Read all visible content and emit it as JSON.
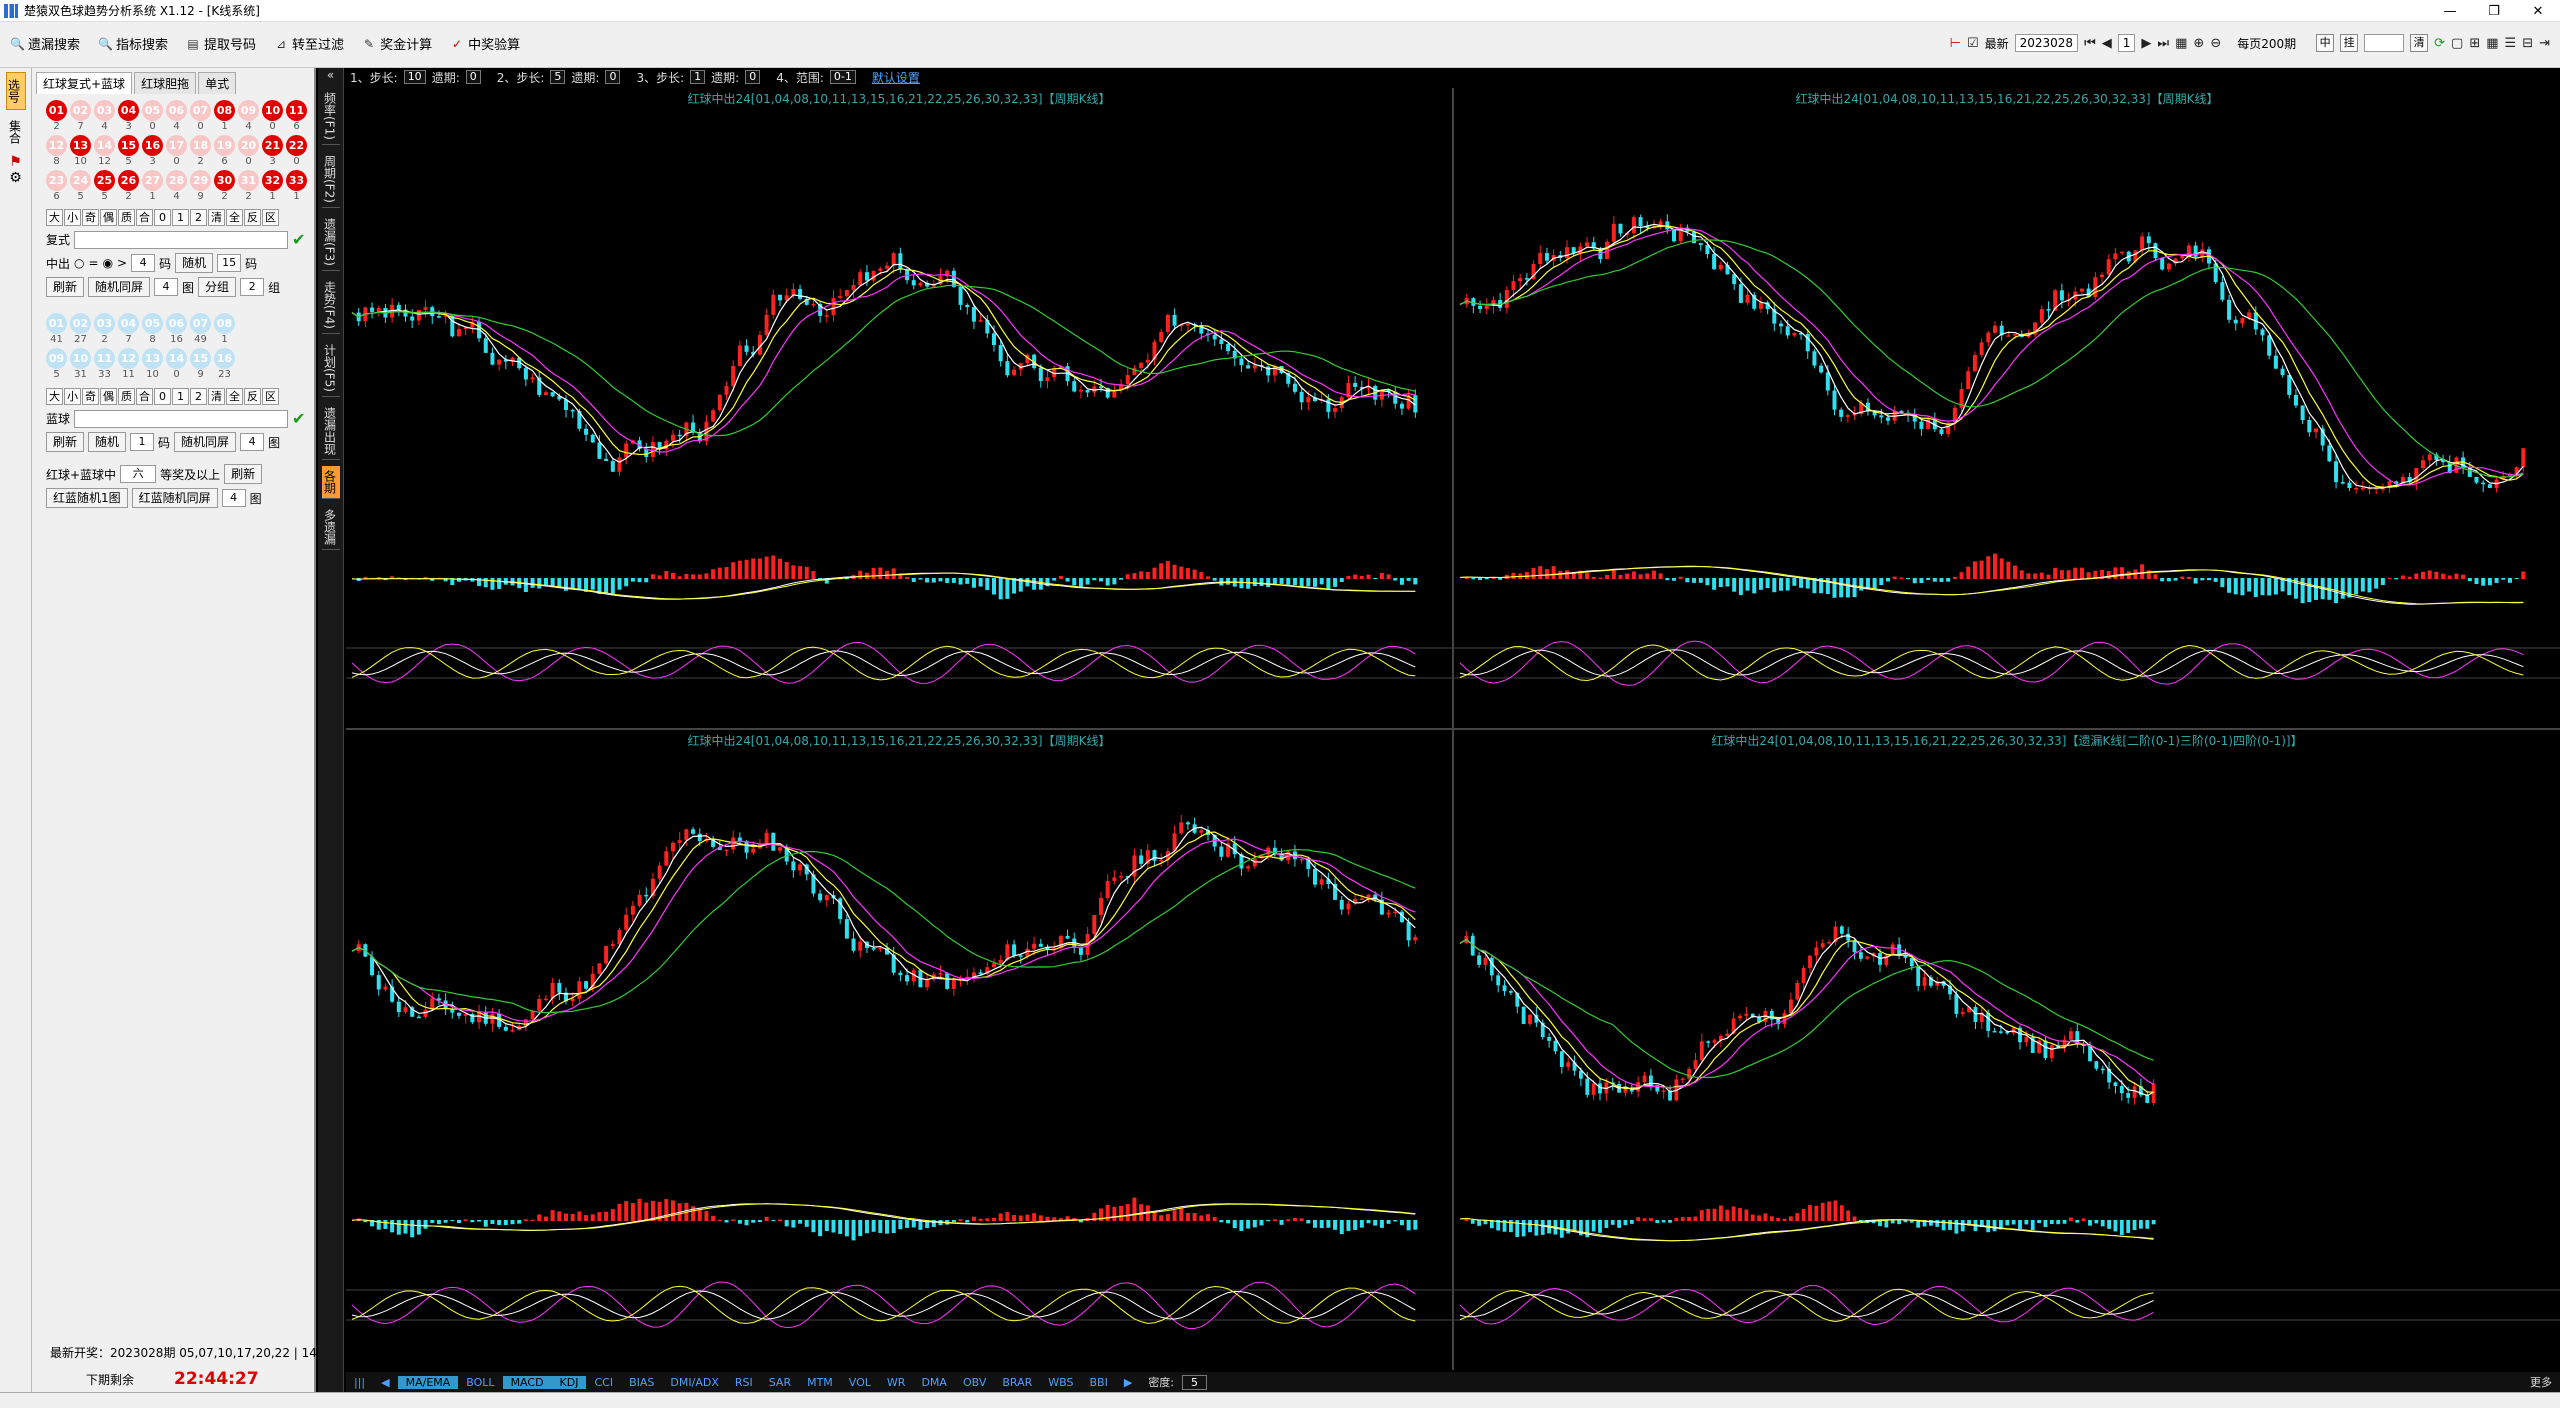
{
  "window": {
    "title": "楚猿双色球趋势分析系统 X1.12 - [K线系统]"
  },
  "toolbar": {
    "items": [
      {
        "name": "search",
        "label": "遗漏搜索"
      },
      {
        "name": "indicator",
        "label": "指标搜索"
      },
      {
        "name": "extract",
        "label": "提取号码"
      },
      {
        "name": "filter",
        "label": "转至过滤"
      },
      {
        "name": "prize",
        "label": "奖金计算"
      },
      {
        "name": "verify",
        "label": "中奖验算"
      }
    ],
    "latest_label": "最新",
    "period_value": "2023028",
    "page_num": "1",
    "per_page_label": "每页200期",
    "mid_label": "中",
    "hang_label": "挂",
    "clear_label": "清"
  },
  "leftstrip": {
    "tabs": [
      "选号",
      "集合"
    ]
  },
  "panel": {
    "tabs": [
      "红球复式+蓝球",
      "红球胆拖",
      "单式"
    ],
    "red_rows": [
      {
        "balls": [
          "01",
          "02",
          "03",
          "04",
          "05",
          "06",
          "07",
          "08",
          "09",
          "10",
          "11"
        ],
        "hits": [
          true,
          false,
          false,
          true,
          false,
          false,
          false,
          true,
          false,
          true,
          true
        ],
        "counts": [
          "2",
          "7",
          "4",
          "3",
          "0",
          "4",
          "0",
          "1",
          "4",
          "0",
          "6"
        ]
      },
      {
        "balls": [
          "12",
          "13",
          "14",
          "15",
          "16",
          "17",
          "18",
          "19",
          "20",
          "21",
          "22"
        ],
        "hits": [
          false,
          true,
          false,
          true,
          true,
          false,
          false,
          false,
          false,
          true,
          true
        ],
        "counts": [
          "8",
          "10",
          "12",
          "5",
          "3",
          "0",
          "2",
          "6",
          "0",
          "3",
          "0"
        ]
      },
      {
        "balls": [
          "23",
          "24",
          "25",
          "26",
          "27",
          "28",
          "29",
          "30",
          "31",
          "32",
          "33"
        ],
        "hits": [
          false,
          false,
          true,
          true,
          false,
          false,
          false,
          true,
          false,
          true,
          true
        ],
        "counts": [
          "6",
          "5",
          "5",
          "2",
          "1",
          "4",
          "9",
          "2",
          "2",
          "1",
          "1"
        ]
      }
    ],
    "filter_keys": [
      "大",
      "小",
      "奇",
      "偶",
      "质",
      "合",
      "0",
      "1",
      "2",
      "清",
      "全",
      "反",
      "区"
    ],
    "fushi_label": "复式",
    "zhongchu_label": "中出",
    "opt_eq": "=",
    "opt_gt": ">",
    "zc_count": "4",
    "ma_label": "码",
    "random_label": "随机",
    "random_count": "15",
    "refresh_label": "刷新",
    "random_sync_label": "随机同屏",
    "sync_count": "4",
    "tu_label": "图",
    "group_label": "分组",
    "group_count": "2",
    "zu_label": "组",
    "blue_rows": [
      {
        "balls": [
          "01",
          "02",
          "03",
          "04",
          "05",
          "06",
          "07",
          "08"
        ],
        "counts": [
          "41",
          "27",
          "2",
          "7",
          "8",
          "16",
          "49",
          "1"
        ]
      },
      {
        "balls": [
          "09",
          "10",
          "11",
          "12",
          "13",
          "14",
          "15",
          "16"
        ],
        "counts": [
          "5",
          "31",
          "33",
          "11",
          "10",
          "0",
          "9",
          "23"
        ]
      }
    ],
    "blue_label": "蓝球",
    "blue_random_count": "1",
    "blue_sync_count": "4",
    "combo_label": "红球+蓝球中",
    "combo_value": "六",
    "combo_suffix": "等奖及以上",
    "rb_random_label": "红蓝随机1图",
    "rb_sync_label": "红蓝随机同屏",
    "rb_sync_count": "4",
    "latest_open": "最新开奖：2023028期 05,07,10,17,20,22 | 14",
    "next_label": "下期剩余",
    "countdown": "22:44:27"
  },
  "vstrip": {
    "tabs": [
      "频率(F1)",
      "周期(F2)",
      "遗漏(F3)",
      "走势(F4)",
      "计划(F5)",
      "遗漏出现",
      "各期",
      "多遗漏"
    ]
  },
  "params": {
    "p1_label": "1、步长:",
    "p1": "10",
    "p1b_label": "遗期:",
    "p1b": "0",
    "p2_label": "2、步长:",
    "p2": "5",
    "p2b_label": "遗期:",
    "p2b": "0",
    "p3_label": "3、步长:",
    "p3": "1",
    "p3b_label": "遗期:",
    "p3b": "0",
    "p4_label": "4、范围:",
    "p4": "0-1",
    "default_label": "默认设置"
  },
  "charts": [
    {
      "title": "红球中出24[01,04,08,10,11,13,15,16,21,22,25,26,30,32,33]【周期K线】"
    },
    {
      "title": "红球中出24[01,04,08,10,11,13,15,16,21,22,25,26,30,32,33]【周期K线】"
    },
    {
      "title": "红球中出24[01,04,08,10,11,13,15,16,21,22,25,26,30,32,33]【周期K线】"
    },
    {
      "title": "红球中出24[01,04,08,10,11,13,15,16,21,22,25,26,30,32,33]【遗漏K线[二阶(0-1)三阶(0-1)四阶(0-1)]】"
    }
  ],
  "indicators": [
    "MA/EMA",
    "BOLL",
    "MACD",
    "KDJ",
    "CCI",
    "BIAS",
    "DMI/ADX",
    "RSI",
    "SAR",
    "MTM",
    "VOL",
    "WR",
    "DMA",
    "OBV",
    "BRAR",
    "WBS",
    "BBI"
  ],
  "indicators_active": [
    "MA/EMA",
    "MACD",
    "KDJ"
  ],
  "bottom_extra": {
    "density_label": "密度:",
    "density_value": "5",
    "more_label": "更多"
  },
  "colors": {
    "up": "#ff2020",
    "down": "#30e0f0",
    "ma1": "#ffffff",
    "ma2": "#ffff33",
    "ma3": "#ff33ff",
    "ma4": "#33cc33"
  }
}
